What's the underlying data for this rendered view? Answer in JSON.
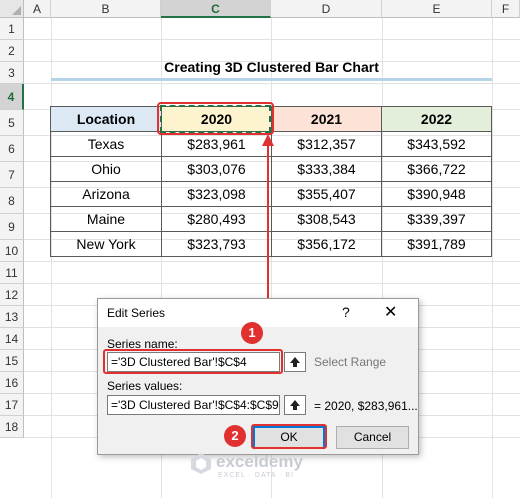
{
  "sheet": {
    "columns": [
      "A",
      "B",
      "C",
      "D",
      "E",
      "F"
    ],
    "rows": [
      "1",
      "2",
      "3",
      "4",
      "5",
      "6",
      "7",
      "8",
      "9",
      "10",
      "11",
      "12",
      "13",
      "14",
      "15",
      "16",
      "17",
      "18"
    ]
  },
  "title": "Creating 3D Clustered Bar Chart",
  "table": {
    "headers": [
      "Location",
      "2020",
      "2021",
      "2022"
    ],
    "rows": [
      [
        "Texas",
        "$283,961",
        "$312,357",
        "$343,592"
      ],
      [
        "Ohio",
        "$303,076",
        "$333,384",
        "$366,722"
      ],
      [
        "Arizona",
        "$323,098",
        "$355,407",
        "$390,948"
      ],
      [
        "Maine",
        "$280,493",
        "$308,543",
        "$339,397"
      ],
      [
        "New York",
        "$323,793",
        "$356,172",
        "$391,789"
      ]
    ]
  },
  "dialog": {
    "title": "Edit Series",
    "help": "?",
    "close": "✕",
    "series_name_label": "Series name:",
    "series_name_value": "='3D Clustered Bar'!$C$4",
    "select_range": "Select Range",
    "series_values_label": "Series values:",
    "series_values_value": "='3D Clustered Bar'!$C$4:$C$9",
    "series_values_preview": "= 2020, $283,961...",
    "ok": "OK",
    "cancel": "Cancel"
  },
  "callouts": {
    "step1": "1",
    "step2": "2"
  },
  "watermark": {
    "name": "exceldemy",
    "tagline": "EXCEL · DATA · BI"
  },
  "colors": {
    "accent_red": "#e03030",
    "excel_green": "#217346",
    "header_location": "#dce9f5",
    "header_2020": "#fdf3cf",
    "header_2021": "#fde3d7",
    "header_2022": "#e3eedb"
  }
}
